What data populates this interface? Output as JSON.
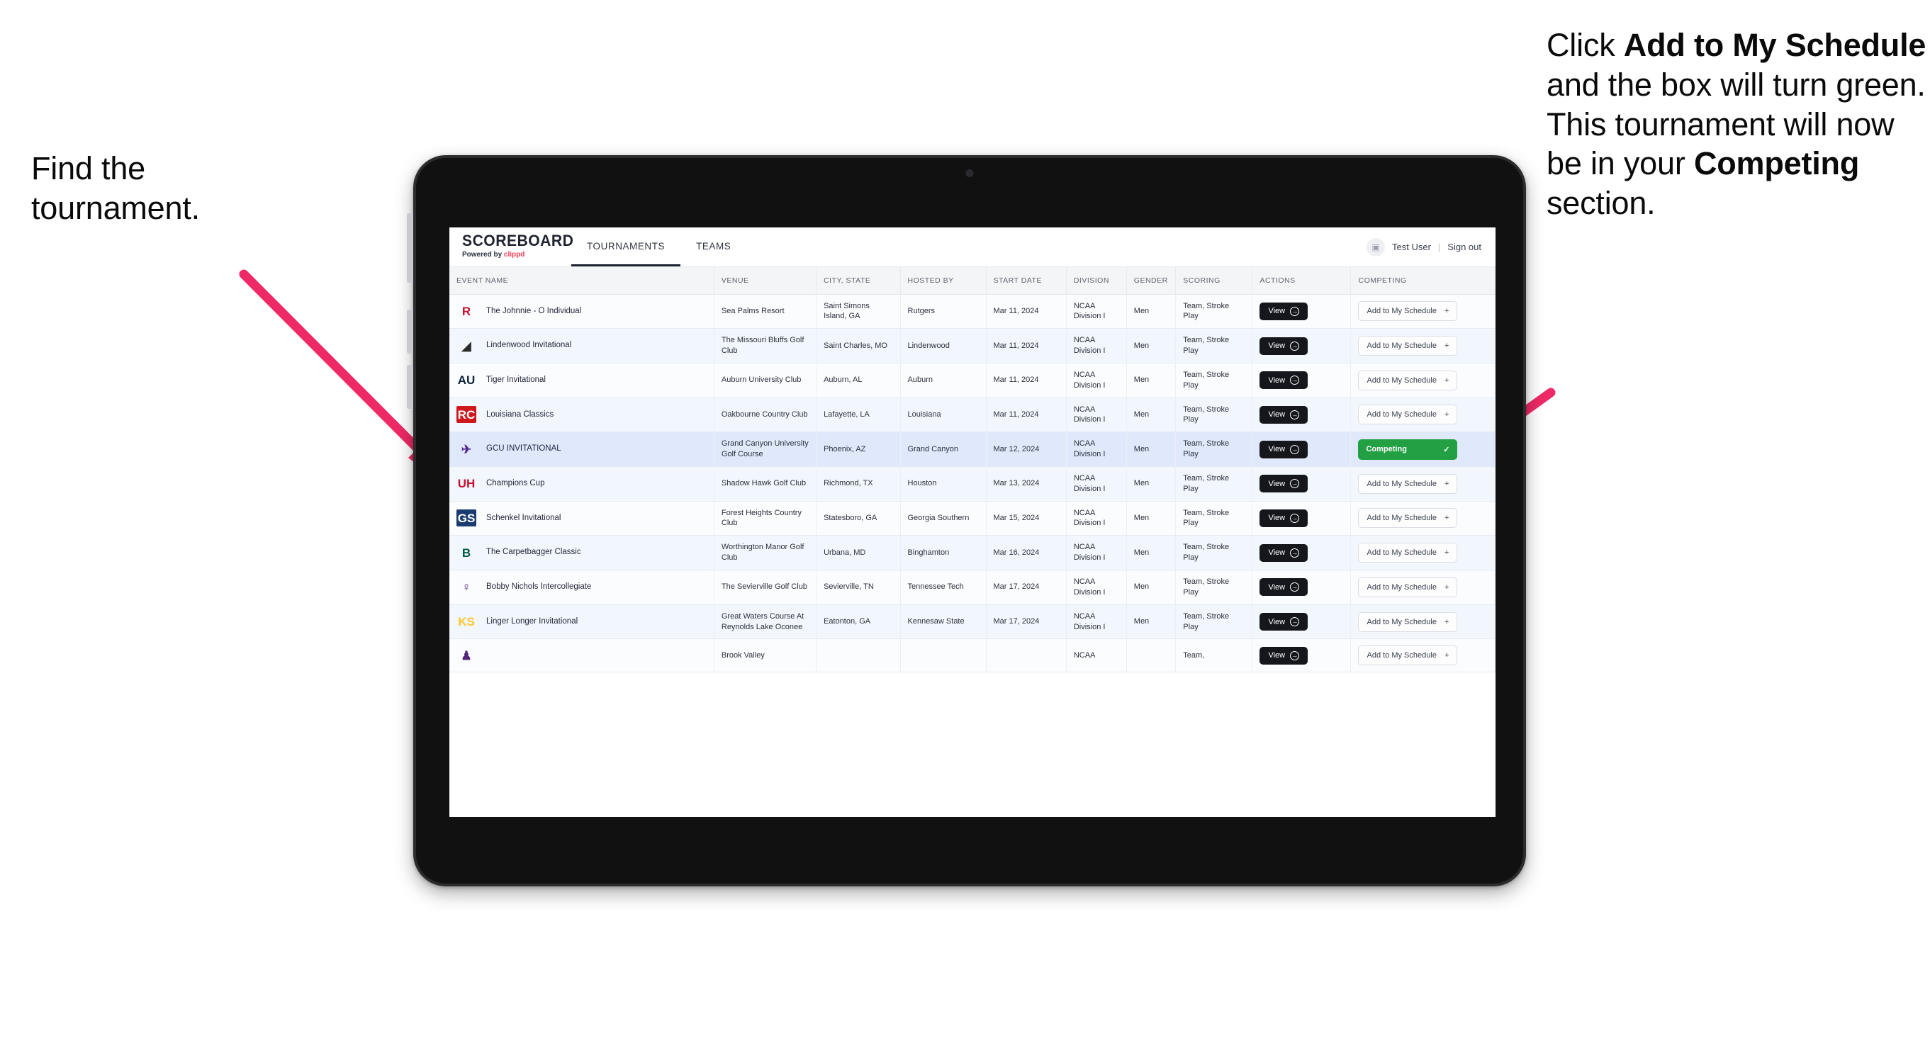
{
  "annotations": {
    "left": {
      "line1": "Find the",
      "line2": "tournament."
    },
    "right": {
      "seg1": "Click ",
      "bold1": "Add to My Schedule",
      "seg2": " and the box will turn green. This tournament will now be in your ",
      "bold2": "Competing",
      "seg3": " section."
    },
    "arrow_color": "#EE2A66"
  },
  "app": {
    "brand": {
      "title": "SCOREBOARD",
      "powered_prefix": "Powered by ",
      "powered_brand": "clippd"
    },
    "tabs": [
      {
        "label": "TOURNAMENTS",
        "active": true
      },
      {
        "label": "TEAMS",
        "active": false
      }
    ],
    "header_right": {
      "user": "Test User",
      "separator": "|",
      "signout": "Sign out",
      "avatar_glyph": "▣"
    },
    "columns": [
      "EVENT NAME",
      "VENUE",
      "CITY, STATE",
      "HOSTED BY",
      "START DATE",
      "DIVISION",
      "GENDER",
      "SCORING",
      "ACTIONS",
      "COMPETING"
    ],
    "buttons": {
      "view": "View",
      "view_icon": "→",
      "add": "Add to My Schedule",
      "add_icon": "+",
      "competing": "Competing",
      "competing_icon": "✓"
    },
    "competing_color": "#22A043",
    "rows": [
      {
        "event": "The Johnnie - O Individual",
        "venue": "Sea Palms Resort",
        "city": "Saint Simons Island, GA",
        "host": "Rutgers",
        "date": "Mar 11, 2024",
        "division": "NCAA Division I",
        "gender": "Men",
        "scoring": "Team, Stroke Play",
        "competing": false,
        "logo": {
          "text": "R",
          "color": "#C8102E",
          "bg": "transparent"
        }
      },
      {
        "event": "Lindenwood Invitational",
        "venue": "The Missouri Bluffs Golf Club",
        "city": "Saint Charles, MO",
        "host": "Lindenwood",
        "date": "Mar 11, 2024",
        "division": "NCAA Division I",
        "gender": "Men",
        "scoring": "Team, Stroke Play",
        "competing": false,
        "logo": {
          "text": "◢",
          "color": "#2b2b2b",
          "bg": "transparent"
        }
      },
      {
        "event": "Tiger Invitational",
        "venue": "Auburn University Club",
        "city": "Auburn, AL",
        "host": "Auburn",
        "date": "Mar 11, 2024",
        "division": "NCAA Division I",
        "gender": "Men",
        "scoring": "Team, Stroke Play",
        "competing": false,
        "logo": {
          "text": "AU",
          "color": "#0C2340",
          "bg": "transparent"
        }
      },
      {
        "event": "Louisiana Classics",
        "venue": "Oakbourne Country Club",
        "city": "Lafayette, LA",
        "host": "Louisiana",
        "date": "Mar 11, 2024",
        "division": "NCAA Division I",
        "gender": "Men",
        "scoring": "Team, Stroke Play",
        "competing": false,
        "logo": {
          "text": "RC",
          "color": "#ffffff",
          "bg": "#CE181E"
        }
      },
      {
        "event": "GCU INVITATIONAL",
        "venue": "Grand Canyon University Golf Course",
        "city": "Phoenix, AZ",
        "host": "Grand Canyon",
        "date": "Mar 12, 2024",
        "division": "NCAA Division I",
        "gender": "Men",
        "scoring": "Team, Stroke Play",
        "competing": true,
        "logo": {
          "text": "✈",
          "color": "#522398",
          "bg": "transparent"
        }
      },
      {
        "event": "Champions Cup",
        "venue": "Shadow Hawk Golf Club",
        "city": "Richmond, TX",
        "host": "Houston",
        "date": "Mar 13, 2024",
        "division": "NCAA Division I",
        "gender": "Men",
        "scoring": "Team, Stroke Play",
        "competing": false,
        "logo": {
          "text": "UH",
          "color": "#C8102E",
          "bg": "transparent"
        }
      },
      {
        "event": "Schenkel Invitational",
        "venue": "Forest Heights Country Club",
        "city": "Statesboro, GA",
        "host": "Georgia Southern",
        "date": "Mar 15, 2024",
        "division": "NCAA Division I",
        "gender": "Men",
        "scoring": "Team, Stroke Play",
        "competing": false,
        "logo": {
          "text": "GS",
          "color": "#ffffff",
          "bg": "#1A3C6E"
        }
      },
      {
        "event": "The Carpetbagger Classic",
        "venue": "Worthington Manor Golf Club",
        "city": "Urbana, MD",
        "host": "Binghamton",
        "date": "Mar 16, 2024",
        "division": "NCAA Division I",
        "gender": "Men",
        "scoring": "Team, Stroke Play",
        "competing": false,
        "logo": {
          "text": "B",
          "color": "#005A43",
          "bg": "transparent"
        }
      },
      {
        "event": "Bobby Nichols Intercollegiate",
        "venue": "The Sevierville Golf Club",
        "city": "Sevierville, TN",
        "host": "Tennessee Tech",
        "date": "Mar 17, 2024",
        "division": "NCAA Division I",
        "gender": "Men",
        "scoring": "Team, Stroke Play",
        "competing": false,
        "logo": {
          "text": "♀",
          "color": "#51247A",
          "bg": "transparent"
        }
      },
      {
        "event": "Linger Longer Invitational",
        "venue": "Great Waters Course At Reynolds Lake Oconee",
        "city": "Eatonton, GA",
        "host": "Kennesaw State",
        "date": "Mar 17, 2024",
        "division": "NCAA Division I",
        "gender": "Men",
        "scoring": "Team, Stroke Play",
        "competing": false,
        "logo": {
          "text": "KS",
          "color": "#FFC629",
          "bg": "transparent"
        }
      },
      {
        "event": "",
        "venue": "Brook Valley",
        "city": "",
        "host": "",
        "date": "",
        "division": "NCAA",
        "gender": "",
        "scoring": "Team,",
        "competing": false,
        "logo": {
          "text": "♟",
          "color": "#51247A",
          "bg": "transparent"
        }
      }
    ]
  }
}
